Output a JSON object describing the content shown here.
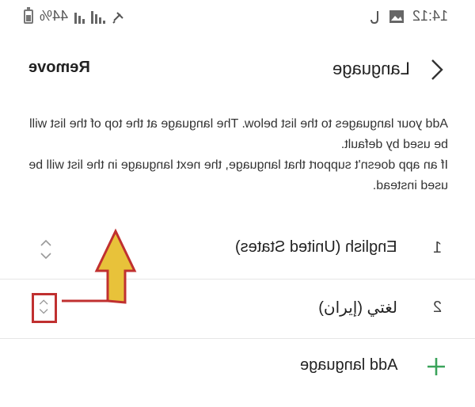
{
  "status_bar": {
    "time": "14:12",
    "battery": "44%"
  },
  "header": {
    "title": "Language",
    "remove_label": "Remove"
  },
  "description": {
    "line1": "Add your languages to the list below. The language at the top of the list will be used by default.",
    "line2": "If an app doesn't support that language, the next language in the list will be used instead."
  },
  "languages": [
    {
      "num": "1",
      "name": "English (United States)"
    },
    {
      "num": "2",
      "name": "لغتي (إيران)"
    }
  ],
  "add_language": {
    "label": "Add language"
  },
  "colors": {
    "accent_green": "#3aa35a",
    "highlight_red": "#c03030",
    "arrow_fill": "#e8c23a"
  }
}
